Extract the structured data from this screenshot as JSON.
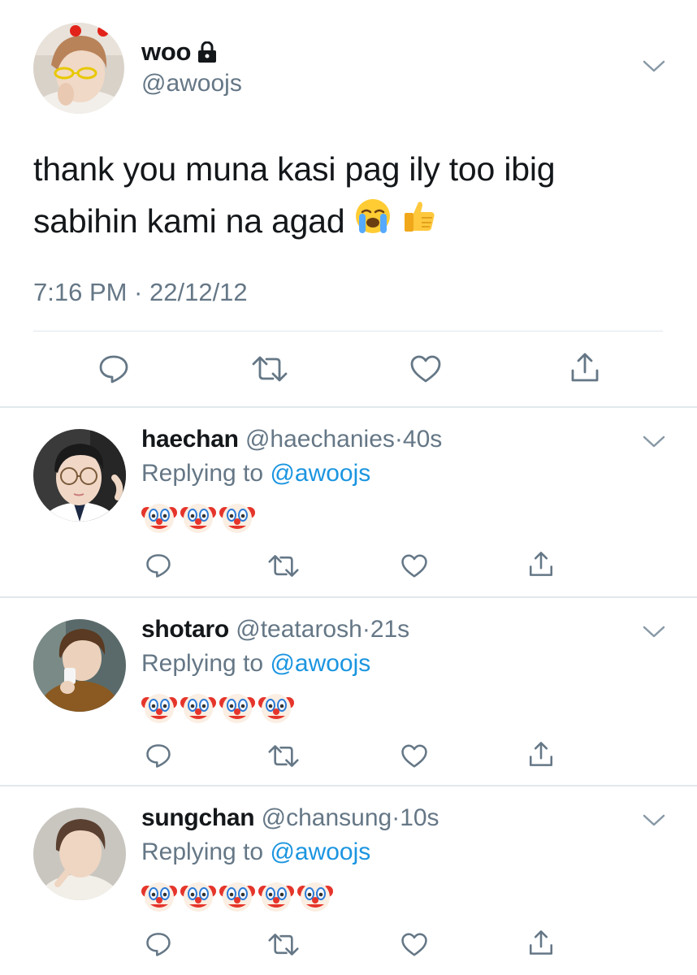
{
  "main_tweet": {
    "name": "woo",
    "handle": "@awoojs",
    "text": "thank you muna kasi pag ily too ibig sabihin kami na agad",
    "emojis": [
      "loudly-crying-face",
      "thumbs-up"
    ],
    "timestamp": "7:16 PM · 22/12/12",
    "locked": true
  },
  "replies": [
    {
      "name": "haechan",
      "handle": "@haechanies",
      "separator": "·",
      "time": "40s",
      "replying_prefix": "Replying to ",
      "replying_to": "@awoojs",
      "clown_count": 3
    },
    {
      "name": "shotaro",
      "handle": "@teatarosh",
      "separator": "·",
      "time": "21s",
      "replying_prefix": "Replying to ",
      "replying_to": "@awoojs",
      "clown_count": 4
    },
    {
      "name": "sungchan",
      "handle": "@chansung",
      "separator": "·",
      "time": "10s",
      "replying_prefix": "Replying to ",
      "replying_to": "@awoojs",
      "clown_count": 5
    }
  ],
  "icons": {
    "reply": "reply-icon",
    "retweet": "retweet-icon",
    "like": "like-icon",
    "share": "share-icon",
    "caret": "chevron-down-icon",
    "lock": "lock-icon"
  },
  "colors": {
    "text_primary": "#14171a",
    "text_secondary": "#657786",
    "link": "#1b95e0",
    "icon": "#657786",
    "divider": "#e1e8ed"
  }
}
